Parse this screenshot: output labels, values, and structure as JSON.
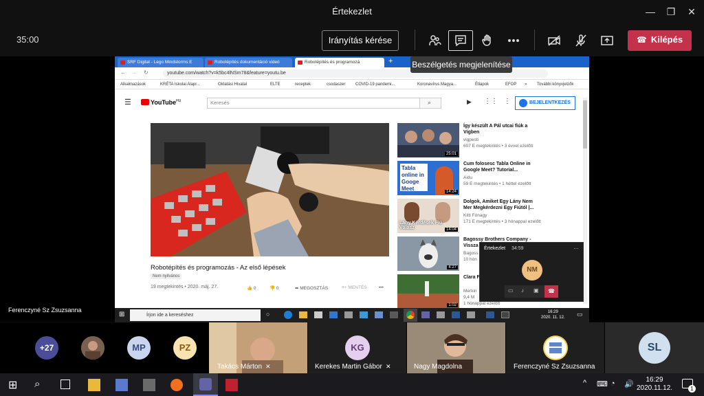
{
  "window": {
    "title": "Értekezlet"
  },
  "toolbar": {
    "elapsed": "35:00",
    "request_control": "Irányítás kérése",
    "leave": "Kilépés",
    "tooltip": "Beszélgetés megjelenítése"
  },
  "shared_screen": {
    "browser_tabs": [
      "SRF Digital - Lego Mindstorms E",
      "Robotépítés dokumentáció videó",
      "Robotépítés és programozá"
    ],
    "url": "youtube.com/watch?v=k5bc4lNSm78&feature=youtu.be",
    "bookmarks": [
      "Alkalmazások",
      "KRÉTA Iskolai Alapr...",
      "Oktatási Hivatal",
      "ELTE",
      "receptek",
      "csodaszer",
      "COVID-19 pandemi...",
      "Koronavírus Magya...",
      "Étlapok",
      "EFOP",
      "»",
      "További könyvjelzők"
    ],
    "youtube": {
      "logo": "YouTube",
      "logo_sup": "HU",
      "search_placeholder": "Keresés",
      "signin": "BEJELENTKEZÉS",
      "video_title": "Robotépítés és programozás - Az első lépések",
      "visibility": "Nem nyilvános",
      "meta": "19 megtekintés • 2020. máj. 27.",
      "likes": "0",
      "dislikes": "0",
      "share": "MEGOSZTÁS",
      "save": "MENTÉS"
    },
    "recommended": [
      {
        "title": "Így készült A Pál utcai fiúk a Vígben",
        "channel": "vigpesti",
        "stats": "607 E megtekintés • 3 évvel ezelőtt",
        "duration": "25:01"
      },
      {
        "title": "Cum folosesc Tabla Online in Google Meet? Tutorial...",
        "channel": "Aidu",
        "stats": "59 E megtekintés • 1 héttel ezelőtt",
        "duration": "14:24",
        "thumb_text": "Tabla online in Googe Meet"
      },
      {
        "title": "Dolgok, Amiket Egy Lány Nem Mer Megkérdezni Egy Fiútól |...",
        "channel": "Kitti Fónagy",
        "stats": "171 E megtekintés • 3 hónappal ezelőtt",
        "duration": "14:04",
        "thumb_text": "Lány Kérdések Fiú Válasz"
      },
      {
        "title": "Bagossy Brothers Company - Vissza",
        "channel": "Bagoss",
        "stats": "10 hón",
        "duration": "4:27"
      },
      {
        "title": "Clara F Vaulter",
        "channel": "Merkin",
        "stats": "9,4 M",
        "stats2": "1 hónappal ezelőtt",
        "duration": "1:02"
      }
    ],
    "taskbar": {
      "search": "Írjon ide a kereséshez",
      "time": "16:29",
      "date": "2020. 11. 12."
    },
    "mini_call": {
      "title": "Értekezlet",
      "time": "34:59",
      "initials": "NM"
    }
  },
  "presenter": "Ferenczyné Sz Zsuzsanna",
  "gallery": {
    "overflow": "+27",
    "avatars": [
      "MP",
      "PZ"
    ],
    "tiles": [
      {
        "name": "Takács Márton"
      },
      {
        "name": "Kerekes Martin Gábor",
        "initials": "KG"
      },
      {
        "name": "Nagy Magdolna"
      },
      {
        "name": "Ferenczyné Sz Zsuzsanna"
      }
    ],
    "self": "SL"
  },
  "windows_taskbar": {
    "time": "16:29",
    "date": "2020.11.12.",
    "notifications": "1"
  },
  "colors": {
    "leave": "#c4314b",
    "accent": "#6264a7",
    "chrome": "#1b63c8"
  }
}
